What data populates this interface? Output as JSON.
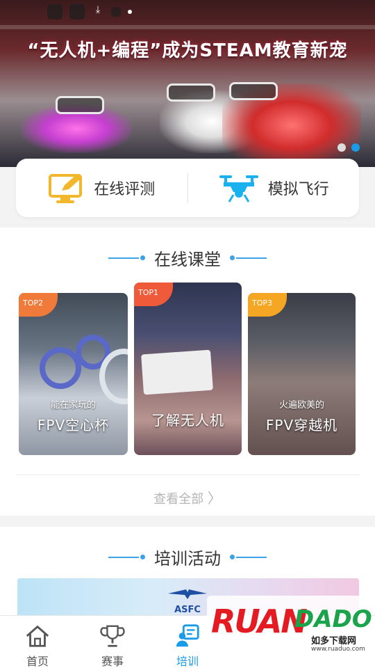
{
  "banner": {
    "title": "“无人机+编程”成为STEAM教育新宠",
    "dots": [
      false,
      true
    ]
  },
  "quick_actions": [
    {
      "label": "在线评测",
      "icon": "monitor-edit-icon"
    },
    {
      "label": "模拟飞行",
      "icon": "drone-icon"
    }
  ],
  "online_class": {
    "title": "在线课堂",
    "cards": [
      {
        "rank": "TOP2",
        "subtitle": "能在家玩的",
        "name": "FPV空心杯",
        "rank_color": "#f07a3a"
      },
      {
        "rank": "TOP1",
        "subtitle": "",
        "name": "了解无人机",
        "rank_color": "#ef5a3a"
      },
      {
        "rank": "TOP3",
        "subtitle": "火遍欧美的",
        "name": "FPV穿越机",
        "rank_color": "#f5a623"
      }
    ],
    "view_all": "查看全部"
  },
  "training": {
    "title": "培训活动",
    "banner_logo": "ASFC"
  },
  "tabbar": [
    {
      "label": "首页",
      "icon": "home-icon",
      "active": false
    },
    {
      "label": "赛事",
      "icon": "trophy-icon",
      "active": false
    },
    {
      "label": "培训",
      "icon": "training-icon",
      "active": true
    }
  ],
  "watermark": {
    "brand": "RUAN",
    "brand2": "DADO",
    "cn": "如多下载网",
    "url": "www.ruaduo.com"
  },
  "colors": {
    "accent": "#1a9be8",
    "title_line": "#3aa2e5"
  }
}
